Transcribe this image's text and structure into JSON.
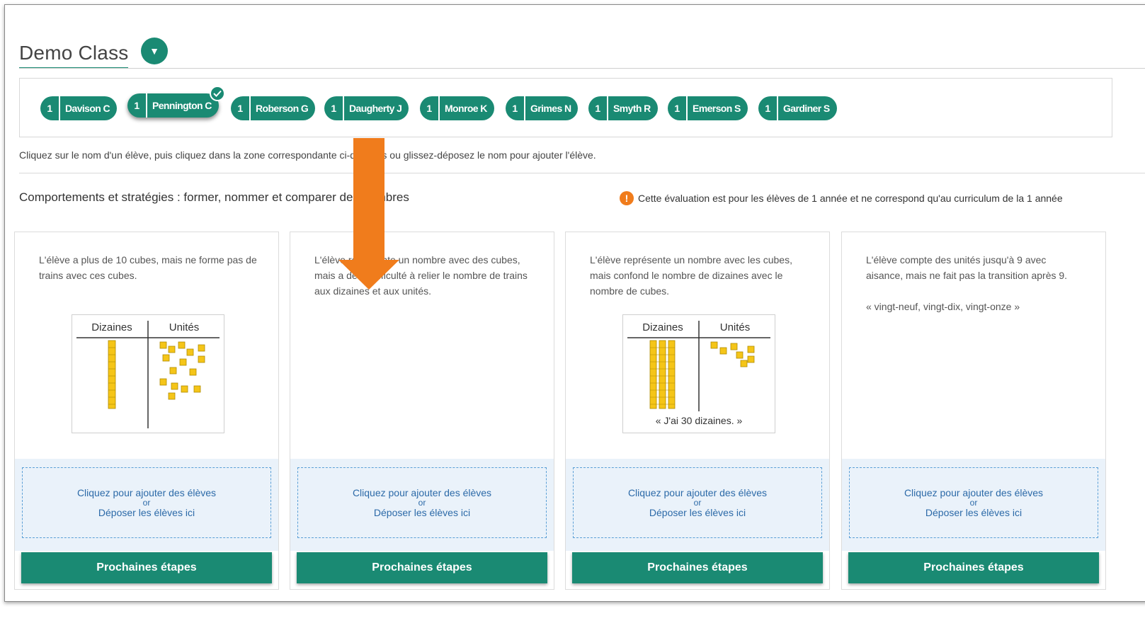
{
  "header": {
    "class_name": "Demo Class"
  },
  "students": [
    {
      "grade": "1",
      "name": "Davison C",
      "selected": false
    },
    {
      "grade": "1",
      "name": "Pennington C",
      "selected": true
    },
    {
      "grade": "1",
      "name": "Roberson G",
      "selected": false
    },
    {
      "grade": "1",
      "name": "Daugherty J",
      "selected": false
    },
    {
      "grade": "1",
      "name": "Monroe K",
      "selected": false
    },
    {
      "grade": "1",
      "name": "Grimes N",
      "selected": false
    },
    {
      "grade": "1",
      "name": "Smyth R",
      "selected": false
    },
    {
      "grade": "1",
      "name": "Emerson S",
      "selected": false
    },
    {
      "grade": "1",
      "name": "Gardiner S",
      "selected": false
    }
  ],
  "instruction": "Cliquez sur le nom d'un élève, puis cliquez dans la zone correspondante ci-dessous ou glissez-déposez le nom pour ajouter l'élève.",
  "section_title": "Comportements et stratégies : former, nommer et comparer des nombres",
  "warning": "Cette évaluation est pour les élèves de 1 année et ne correspond qu'au curriculum de la 1 année",
  "table_labels": {
    "tens": "Dizaines",
    "units": "Unités",
    "caption": "« J'ai 30 dizaines. »"
  },
  "cards": [
    {
      "description": "L'élève a plus de 10 cubes, mais ne forme pas de trains avec ces cubes.",
      "quote": ""
    },
    {
      "description": "L'élève représente un nombre avec des cubes, mais a de la difficulté à relier le nombre de trains aux dizaines et aux unités.",
      "quote": ""
    },
    {
      "description": "L'élève représente un nombre avec les cubes, mais confond le nombre de dizaines avec le nombre de cubes.",
      "quote": ""
    },
    {
      "description": "L'élève compte des unités jusqu'à 9 avec aisance, mais ne fait pas la transition après 9.",
      "quote": "« vingt-neuf, vingt-dix, vingt-onze »"
    }
  ],
  "dropzone": {
    "line1": "Cliquez pour ajouter des élèves",
    "or": "or",
    "line2": "Déposer les élèves ici"
  },
  "next_button": "Prochaines étapes",
  "colors": {
    "teal": "#1a8a73",
    "arrow": "#f07c1c",
    "drop_border": "#5a9fd6",
    "warning": "#f07c1c"
  }
}
